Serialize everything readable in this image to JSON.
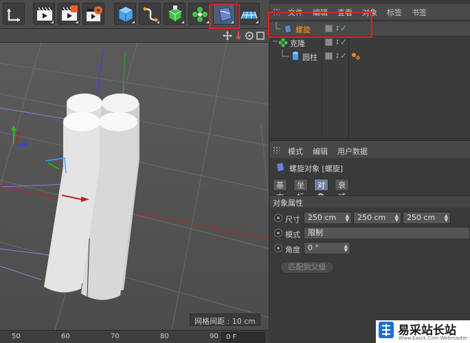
{
  "toolbar": {
    "tools": [
      "coordinate-tool-icon",
      "render-view-icon",
      "render-settings-icon",
      "render-gear-icon",
      "cube-icon",
      "spline-pen-icon",
      "nurbs-icon",
      "mograph-cloner-icon",
      "deformer-twist-icon",
      "floor-grid-icon"
    ]
  },
  "viewport": {
    "grid_spacing_label": "网格间距 : 10 cm"
  },
  "timeline": {
    "ticks": [
      "50",
      "60",
      "70",
      "80",
      "90"
    ],
    "current_frame": "0 F"
  },
  "object_manager": {
    "menu": [
      "文件",
      "编辑",
      "查看",
      "对象",
      "标签",
      "书签"
    ],
    "objects": [
      {
        "name": "螺旋",
        "active": true
      },
      {
        "name": "克隆",
        "active": false
      },
      {
        "name": "圆柱",
        "active": false
      }
    ]
  },
  "attribute_manager": {
    "menu": [
      "模式",
      "编辑",
      "用户数据"
    ],
    "object_title": "螺旋对象 [螺旋]",
    "tabs": [
      "基本",
      "坐标",
      "对象",
      "衰减"
    ],
    "active_tab": "对象",
    "section_title": "对象属性",
    "size_label": "尺寸",
    "size_values": [
      "250 cm",
      "250 cm",
      "250 cm"
    ],
    "mode_label": "模式",
    "mode_value": "限制",
    "angle_label": "角度",
    "angle_value": "0 °",
    "match_parent_button": "匹配到父级"
  },
  "watermark": {
    "site_name": "易采站长站",
    "site_url": "Www.Easck.Com Webmaster"
  },
  "colors": {
    "highlight_box": "#e02020",
    "active_object": "#ff9a20",
    "active_tab": "#6d7f99",
    "check_green": "#5ad05a"
  }
}
